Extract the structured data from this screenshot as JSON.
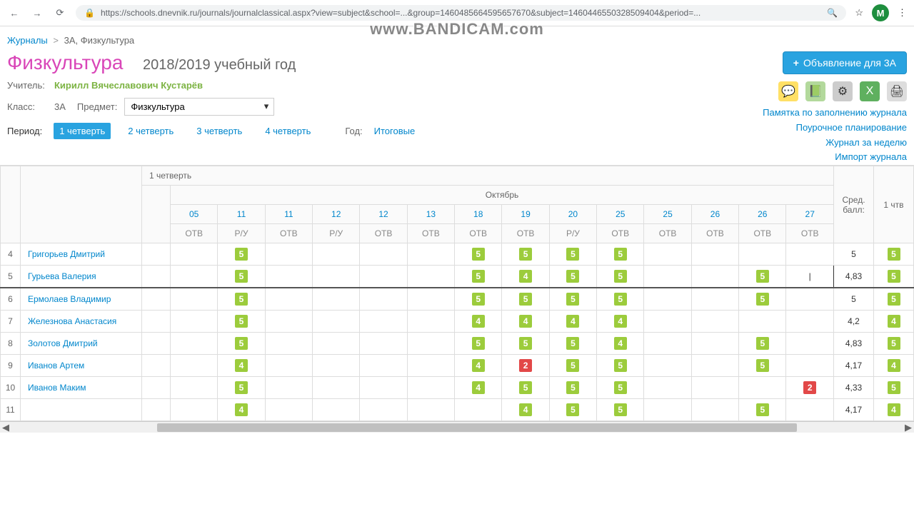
{
  "browser": {
    "url": "https://schools.dnevnik.ru/journals/journalclassical.aspx?view=subject&school=...&group=1460485664595657670&subject=1460446550328509404&period=...",
    "avatar_letter": "М"
  },
  "watermark": "www.BANDICAM.com",
  "breadcrumb": {
    "root": "Журналы",
    "current": "3А, Физкультура"
  },
  "title": "Физкультура",
  "year_text": "2018/2019 учебный год",
  "announce_btn": "Объявление для 3А",
  "side_links": [
    "Памятка по заполнению журнала",
    "Поурочное планирование",
    "Журнал за неделю",
    "Импорт журнала"
  ],
  "meta": {
    "teacher_lbl": "Учитель:",
    "teacher_name": "Кирилл Вячеславович Кустарёв",
    "class_lbl": "Класс:",
    "class_val": "3А",
    "subject_lbl": "Предмет:",
    "subject_val": "Физкультура",
    "period_lbl": "Период:",
    "periods": [
      "1 четверть",
      "2 четверть",
      "3 четверть",
      "4 четверть"
    ],
    "year_lbl": "Год:",
    "final_lbl": "Итоговые"
  },
  "table": {
    "quarter_header": "1 четверть",
    "month": "Октябрь",
    "dates": [
      "05",
      "11",
      "11",
      "12",
      "12",
      "13",
      "18",
      "19",
      "20",
      "25",
      "25",
      "26",
      "26",
      "27"
    ],
    "types": [
      "ОТВ",
      "Р/У",
      "ОТВ",
      "Р/У",
      "ОТВ",
      "ОТВ",
      "ОТВ",
      "ОТВ",
      "Р/У",
      "ОТВ",
      "ОТВ",
      "ОТВ",
      "ОТВ",
      "ОТВ"
    ],
    "avg_header": "Сред. балл:",
    "qtr_header": "1 чтв",
    "rows": [
      {
        "n": 4,
        "name": "Григорьев Дмитрий",
        "cells": [
          "",
          "5",
          "",
          "",
          "",
          "",
          "5",
          "5",
          "5",
          "5",
          "",
          "",
          "",
          ""
        ],
        "avg": "5",
        "q": "5"
      },
      {
        "n": 5,
        "name": "Гурьева Валерия",
        "cells": [
          "",
          "5",
          "",
          "",
          "",
          "",
          "5",
          "4",
          "5",
          "5",
          "",
          "",
          "5",
          "CURSOR"
        ],
        "avg": "4,83",
        "q": "5"
      },
      {
        "n": 6,
        "name": "Ермолаев Владимир",
        "cells": [
          "",
          "5",
          "",
          "",
          "",
          "",
          "5",
          "5",
          "5",
          "5",
          "",
          "",
          "5",
          ""
        ],
        "avg": "5",
        "q": "5",
        "thick": true
      },
      {
        "n": 7,
        "name": "Железнова Анастасия",
        "cells": [
          "",
          "5",
          "",
          "",
          "",
          "",
          "4",
          "4",
          "4",
          "4",
          "",
          "",
          "",
          ""
        ],
        "avg": "4,2",
        "q": "4"
      },
      {
        "n": 8,
        "name": "Золотов Дмитрий",
        "cells": [
          "",
          "5",
          "",
          "",
          "",
          "",
          "5",
          "5",
          "5",
          "4",
          "",
          "",
          "5",
          ""
        ],
        "avg": "4,83",
        "q": "5"
      },
      {
        "n": 9,
        "name": "Иванов Артем",
        "cells": [
          "",
          "4",
          "",
          "",
          "",
          "",
          "4",
          "2",
          "5",
          "5",
          "",
          "",
          "5",
          ""
        ],
        "avg": "4,17",
        "q": "4"
      },
      {
        "n": 10,
        "name": "Иванов Маким",
        "cells": [
          "",
          "5",
          "",
          "",
          "",
          "",
          "4",
          "5",
          "5",
          "5",
          "",
          "",
          "",
          "2"
        ],
        "avg": "4,33",
        "q": "5"
      },
      {
        "n": 11,
        "name": "",
        "cells": [
          "",
          "4",
          "",
          "",
          "",
          "",
          "",
          "4",
          "5",
          "5",
          "",
          "",
          "5",
          ""
        ],
        "avg": "4,17",
        "q": "4"
      }
    ]
  }
}
